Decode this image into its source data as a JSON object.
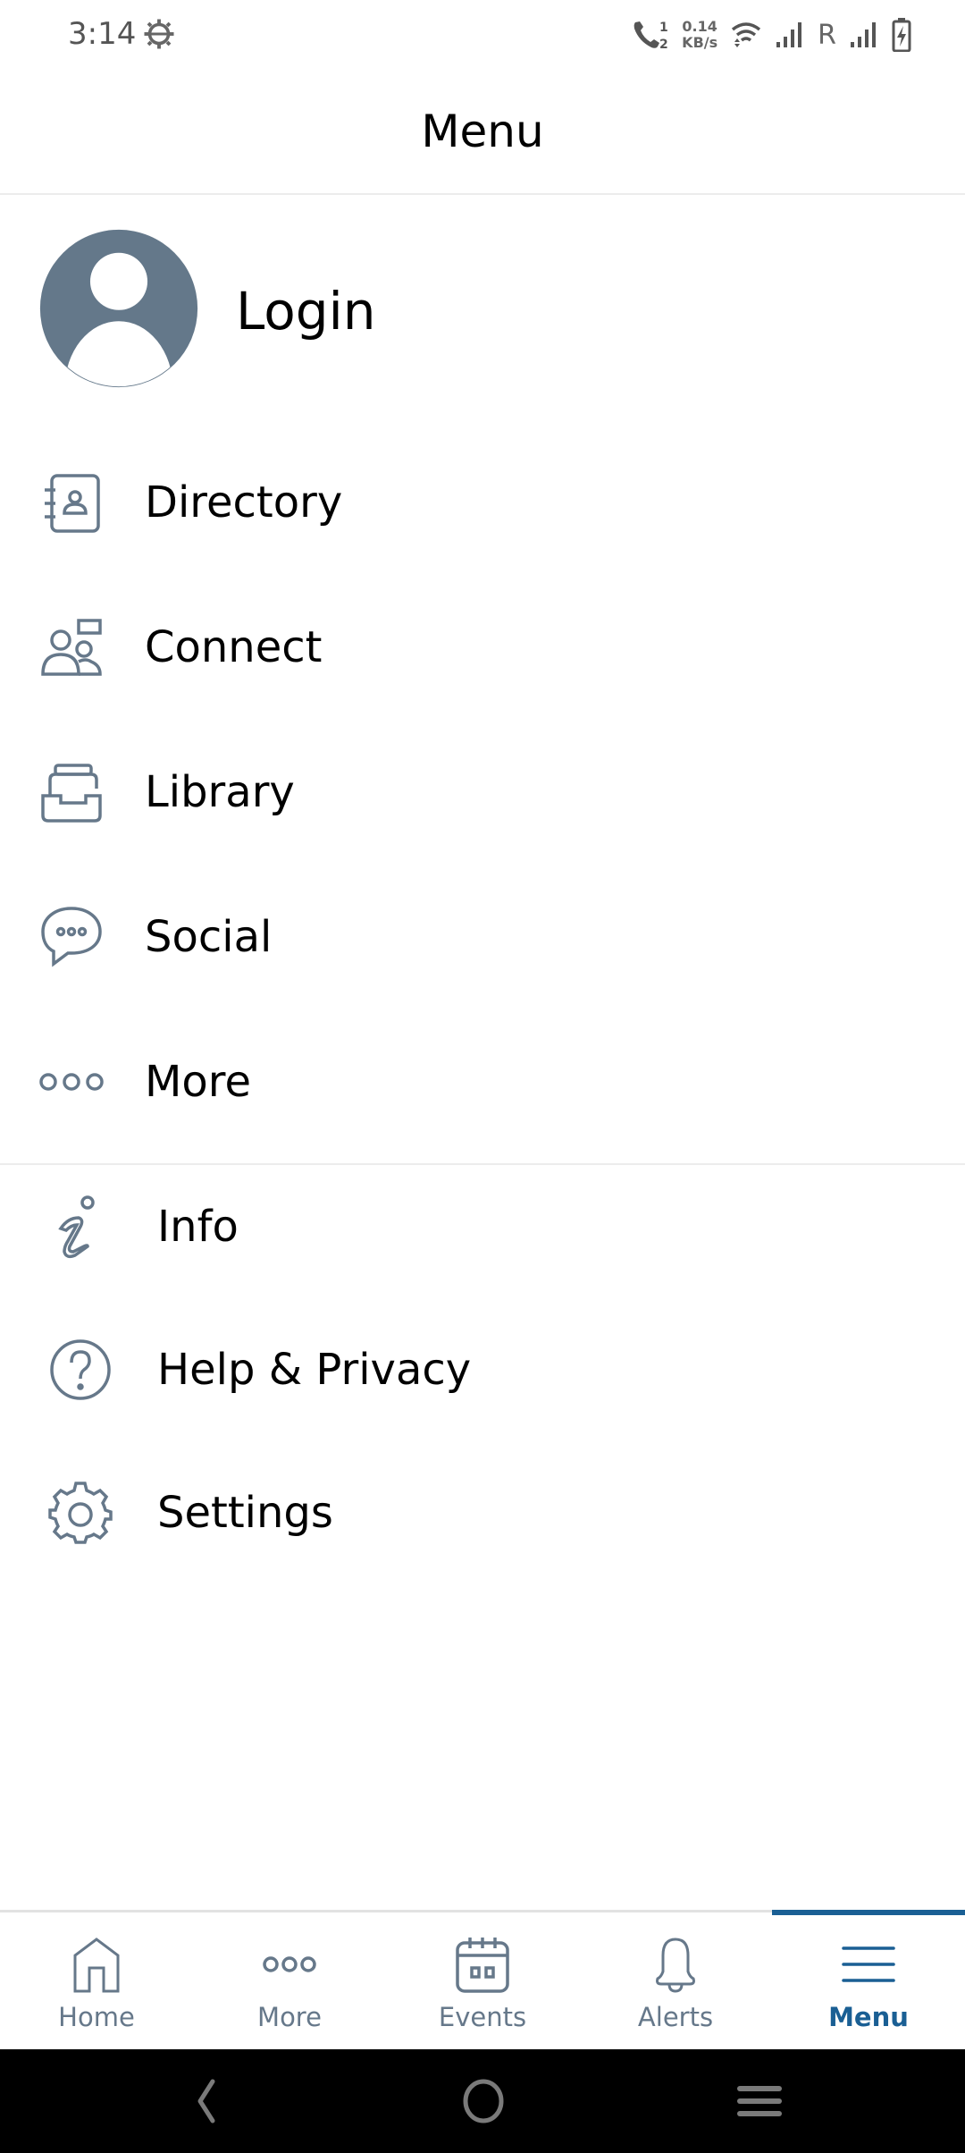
{
  "status_bar": {
    "time": "3:14",
    "net_speed_value": "0.14",
    "net_speed_unit": "KB/s",
    "roaming": "R",
    "icons": [
      "settings-gear-icon",
      "call-sim-icon",
      "wifi-icon",
      "signal-icon",
      "signal-icon",
      "battery-charging-icon"
    ]
  },
  "header": {
    "title": "Menu"
  },
  "login": {
    "label": "Login",
    "icon": "avatar-icon"
  },
  "menu_primary": [
    {
      "label": "Directory",
      "icon": "address-book-icon"
    },
    {
      "label": "Connect",
      "icon": "people-chat-icon"
    },
    {
      "label": "Library",
      "icon": "inbox-tray-icon"
    },
    {
      "label": "Social",
      "icon": "speech-bubble-icon"
    },
    {
      "label": "More",
      "icon": "ellipsis-icon"
    }
  ],
  "menu_secondary": [
    {
      "label": "Info",
      "icon": "info-icon"
    },
    {
      "label": "Help & Privacy",
      "icon": "help-icon"
    },
    {
      "label": "Settings",
      "icon": "settings-icon"
    }
  ],
  "tab_bar": {
    "active": "Menu",
    "tabs": [
      {
        "label": "Home",
        "icon": "home-icon"
      },
      {
        "label": "More",
        "icon": "ellipsis-icon"
      },
      {
        "label": "Events",
        "icon": "calendar-icon"
      },
      {
        "label": "Alerts",
        "icon": "bell-icon",
        "has_badge": true
      },
      {
        "label": "Menu",
        "icon": "hamburger-icon"
      }
    ]
  },
  "colors": {
    "accent": "#1a5f94",
    "icon_gray": "#66788a",
    "badge": "#f00000",
    "divider": "#ececec"
  }
}
